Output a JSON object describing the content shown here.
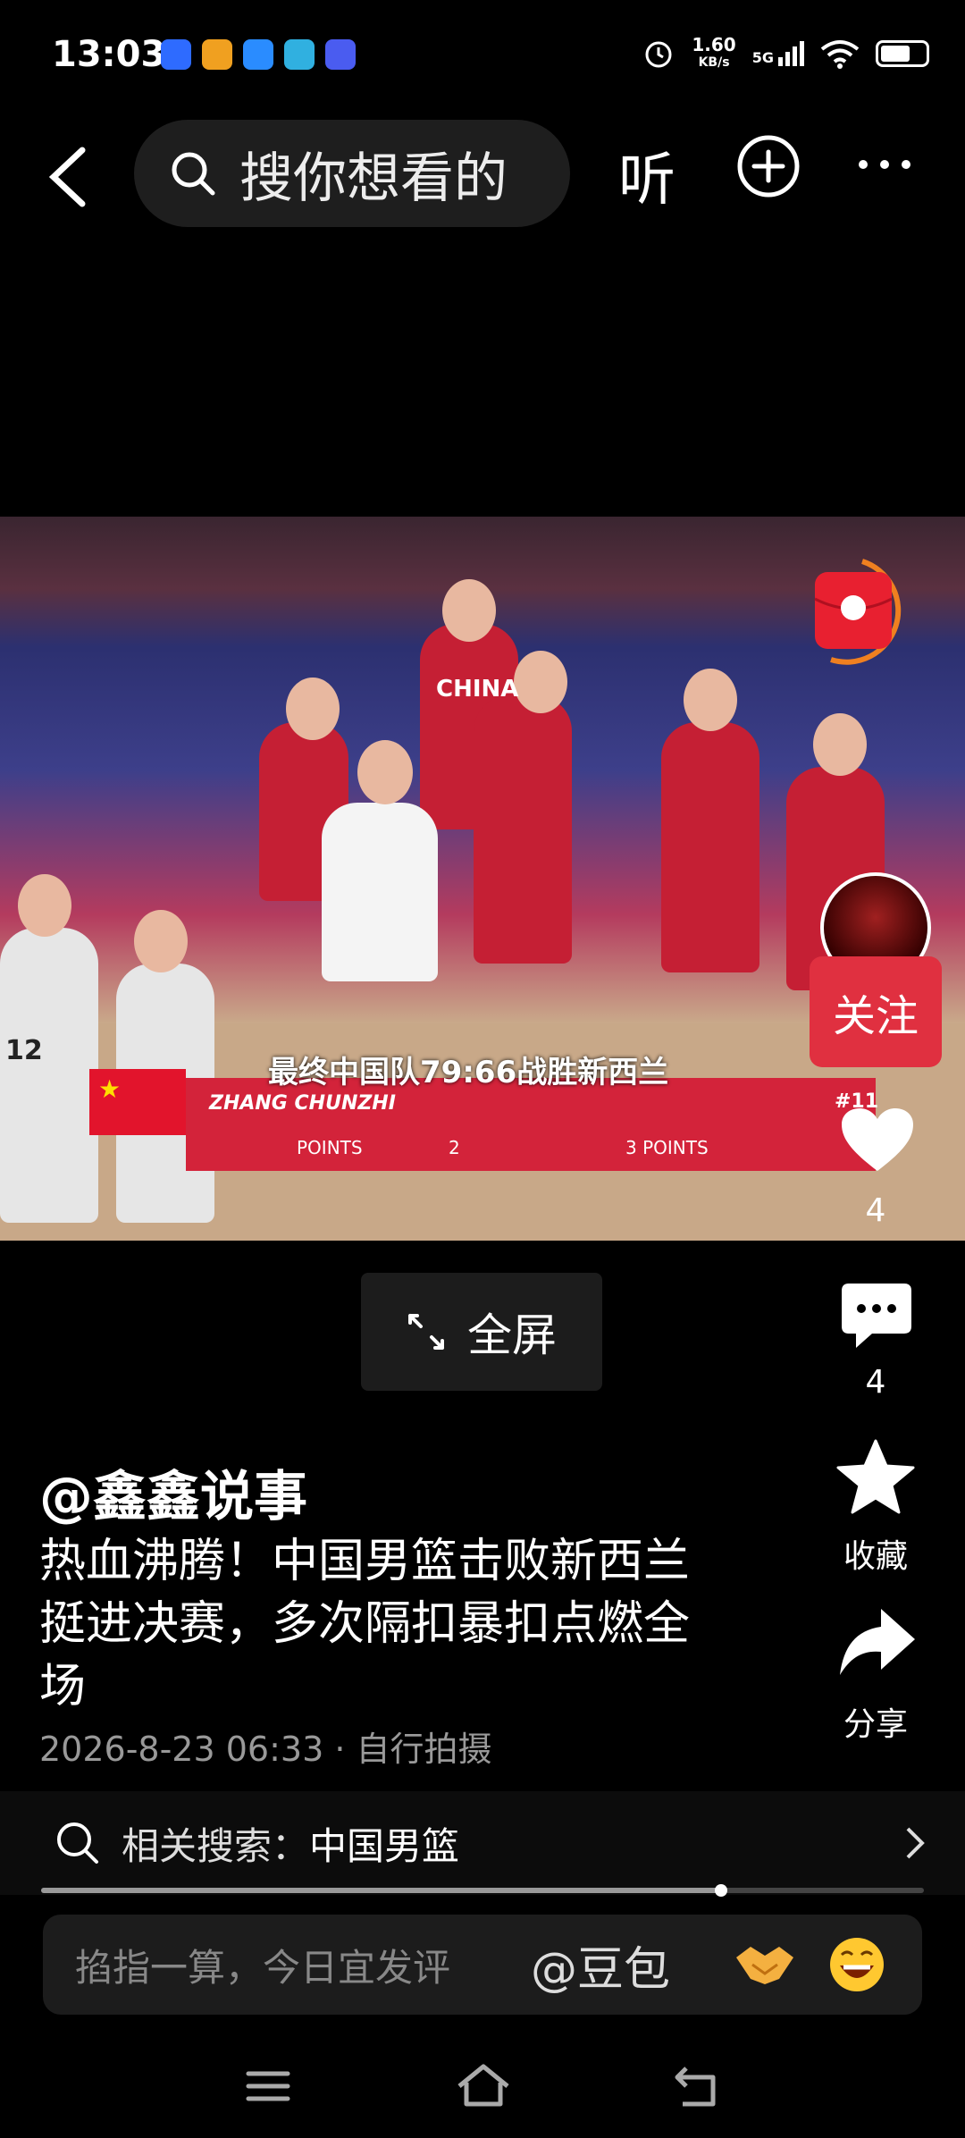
{
  "status_bar": {
    "time": "13:03",
    "net_speed": "1.60",
    "net_unit": "KB/s",
    "network": "5G"
  },
  "top_bar": {
    "search_placeholder": "搜你想看的",
    "listen_label": "听"
  },
  "video": {
    "subtitle": "最终中国队79:66战胜新西兰",
    "player_name": "ZHANG CHUNZHI",
    "player_number": "#11",
    "stat_labels": [
      "POINTS",
      "2",
      "3 POINTS"
    ],
    "jersey_text": "CHINA",
    "jersey_number": "12"
  },
  "sidebar": {
    "follow_label": "关注",
    "like_count": "4",
    "comment_count": "4",
    "favorite_label": "收藏",
    "share_label": "分享"
  },
  "fullscreen_label": "全屏",
  "post": {
    "author": "@鑫鑫说事",
    "description": "热血沸腾！中国男篮击败新西兰挺进决赛，多次隔扣暴扣点燃全场",
    "date": "2026-8-23 06:33",
    "source": "自行拍摄"
  },
  "related_search": {
    "label": "相关搜索：",
    "term": "中国男篮"
  },
  "video_progress": 0.77,
  "comment_bar": {
    "placeholder": "掐指一算，今日宜发评",
    "mention": "@豆包"
  },
  "icons": [
    "back-icon",
    "search-icon",
    "add-icon",
    "more-icon",
    "red-packet-icon",
    "heart-icon",
    "comment-icon",
    "star-icon",
    "share-icon",
    "expand-icon",
    "chevron-right-icon",
    "handshake-emoji",
    "laugh-emoji",
    "menu-icon",
    "home-icon",
    "return-icon"
  ]
}
